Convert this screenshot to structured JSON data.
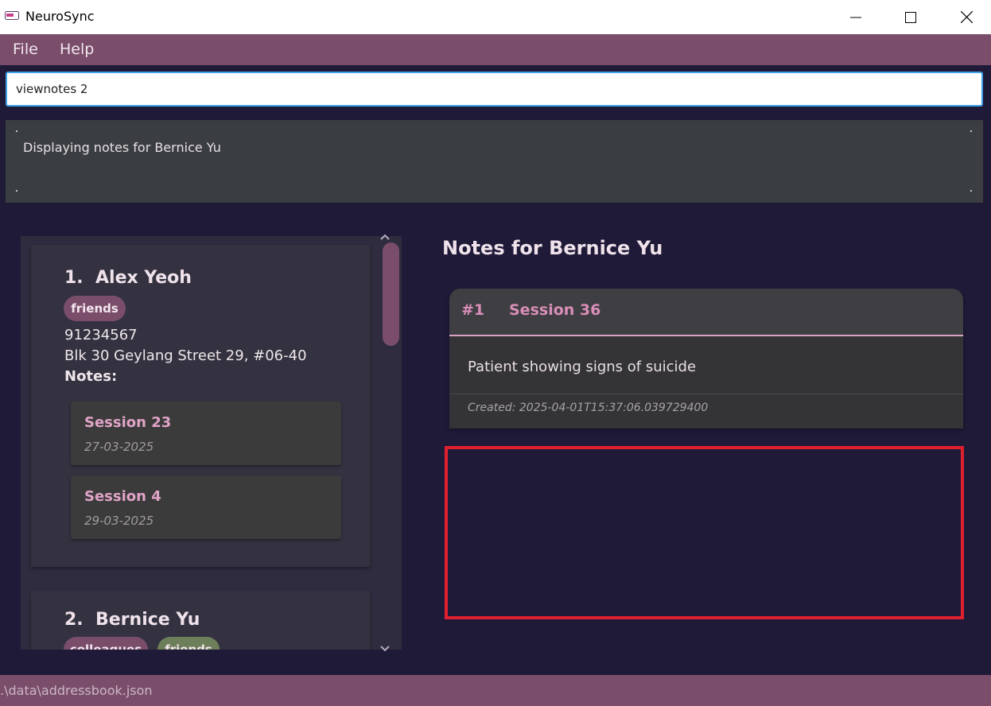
{
  "window": {
    "title": "NeuroSync"
  },
  "menu": {
    "file": "File",
    "help": "Help"
  },
  "command": {
    "value": "viewnotes 2"
  },
  "result": {
    "message": "Displaying notes for Bernice Yu"
  },
  "persons": [
    {
      "index": "1.",
      "name": "Alex Yeoh",
      "tags": [
        "friends"
      ],
      "phone": "91234567",
      "address": "Blk 30 Geylang Street 29, #06-40",
      "notes_label": "Notes:",
      "notes": [
        {
          "title": "Session 23",
          "date": "27-03-2025"
        },
        {
          "title": "Session 4",
          "date": "29-03-2025"
        }
      ]
    },
    {
      "index": "2.",
      "name": "Bernice Yu",
      "tags": [
        "colleagues",
        "friends"
      ]
    }
  ],
  "notes_view": {
    "heading": "Notes for Bernice Yu",
    "notes": [
      {
        "index": "#1",
        "title": "Session 36",
        "content": "Patient showing signs of suicide",
        "created": "Created: 2025-04-01T15:37:06.039729400"
      }
    ]
  },
  "status": {
    "path": ".\\data\\addressbook.json"
  },
  "colors": {
    "accent": "#7a4e6b",
    "background": "#1e1a38",
    "note_title": "#d98fb8",
    "highlight": "#e0202e"
  }
}
